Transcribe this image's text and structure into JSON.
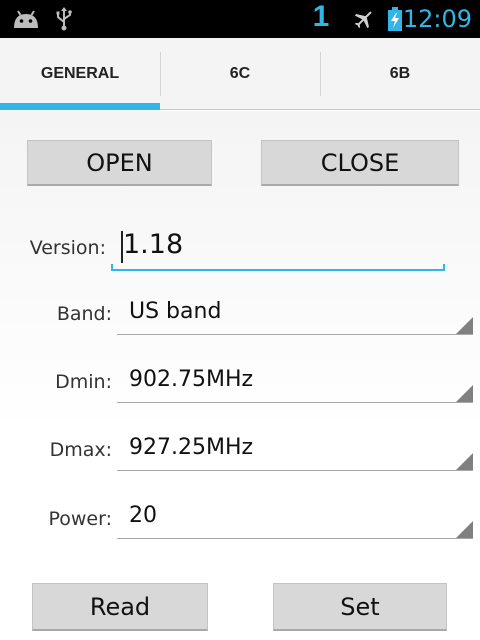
{
  "status_bar": {
    "signal_text": "1",
    "time": "12:09",
    "icons": [
      "android-icon",
      "usb-icon",
      "airplane-icon",
      "battery-charging-icon"
    ]
  },
  "tabs": [
    {
      "label": "GENERAL",
      "active": true
    },
    {
      "label": "6C",
      "active": false
    },
    {
      "label": "6B",
      "active": false
    }
  ],
  "buttons": {
    "open": "OPEN",
    "close": "CLOSE",
    "read": "Read",
    "set": "Set"
  },
  "form": {
    "version_label": "Version:",
    "version_value": "1.18",
    "band_label": "Band:",
    "band_value": "US band",
    "dmin_label": "Dmin:",
    "dmin_value": "902.75MHz",
    "dmax_label": "Dmax:",
    "dmax_value": "927.25MHz",
    "power_label": "Power:",
    "power_value": "20"
  },
  "colors": {
    "accent": "#33b5e5",
    "status_bar_bg": "#000000",
    "button_bg": "#d8d8d8"
  }
}
